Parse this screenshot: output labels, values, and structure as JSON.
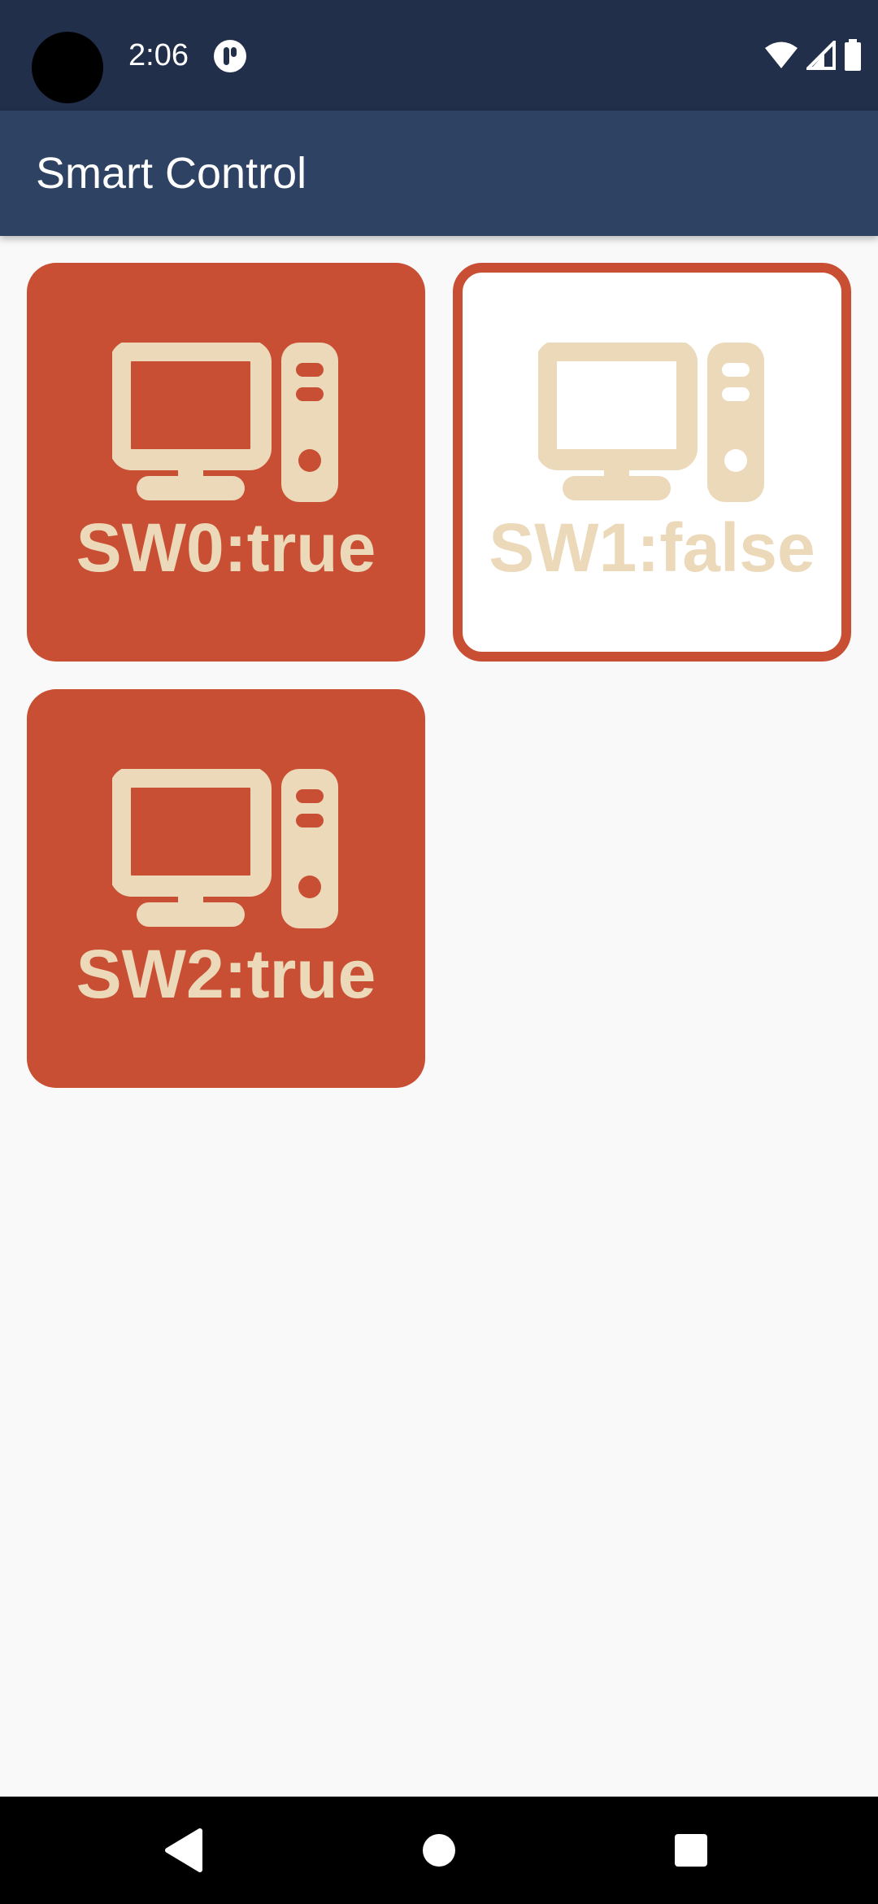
{
  "status_bar": {
    "time": "2:06",
    "app_icon": "app-notification-icon",
    "wifi_icon": "wifi-icon",
    "signal_icon": "cell-signal-icon",
    "battery_icon": "battery-icon"
  },
  "app_bar": {
    "title": "Smart Control"
  },
  "switches": [
    {
      "label": "SW0:true",
      "state": true,
      "icon": "desktop-computer-icon"
    },
    {
      "label": "SW1:false",
      "state": false,
      "icon": "desktop-computer-icon"
    },
    {
      "label": "SW2:true",
      "state": true,
      "icon": "desktop-computer-icon"
    }
  ],
  "colors": {
    "status_bar": "#212f4a",
    "app_bar": "#2e4263",
    "tile_on": "#c84f33",
    "tile_off": "#ffffff",
    "icon_and_text": "#ecd9b9",
    "background": "#f9f9f9"
  },
  "nav_bar": {
    "back_icon": "back-triangle-icon",
    "home_icon": "home-circle-icon",
    "recents_icon": "recents-square-icon"
  }
}
